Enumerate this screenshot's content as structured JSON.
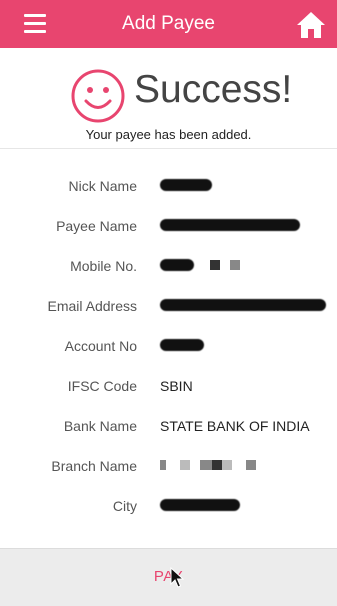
{
  "header": {
    "title": "Add Payee",
    "menu_icon": "hamburger-menu-icon",
    "home_icon": "home-icon"
  },
  "success": {
    "title": "Success!",
    "message": "Your payee has been added.",
    "icon": "smiley-icon"
  },
  "details": [
    {
      "label": "Nick Name",
      "value": null,
      "redacted": true
    },
    {
      "label": "Payee Name",
      "value": null,
      "redacted": true
    },
    {
      "label": "Mobile No.",
      "value": null,
      "redacted": true
    },
    {
      "label": "Email Address",
      "value": null,
      "redacted": true
    },
    {
      "label": "Account No",
      "value": null,
      "redacted": true
    },
    {
      "label": "IFSC Code",
      "value": "SBIN",
      "redacted": false
    },
    {
      "label": "Bank Name",
      "value": "STATE BANK OF INDIA",
      "redacted": false
    },
    {
      "label": "Branch Name",
      "value": null,
      "redacted": true
    },
    {
      "label": "City",
      "value": null,
      "redacted": true
    }
  ],
  "footer": {
    "pay_label": "PAY"
  },
  "colors": {
    "accent": "#e8456f"
  }
}
